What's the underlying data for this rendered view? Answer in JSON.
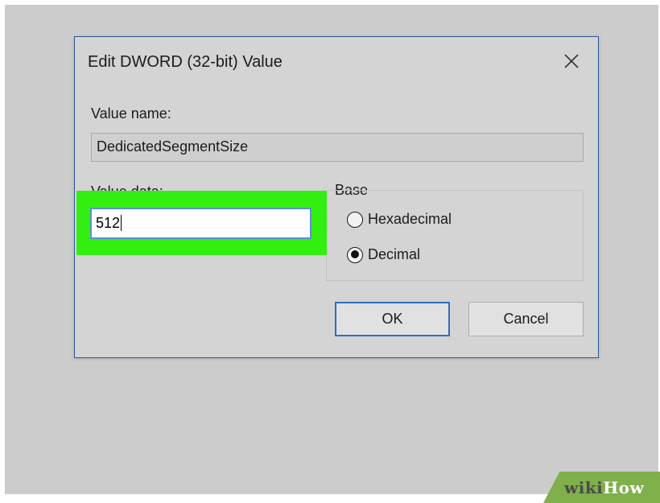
{
  "dialog": {
    "title": "Edit DWORD (32-bit) Value",
    "value_name_label": "Value name:",
    "value_name": "DedicatedSegmentSize",
    "value_data_label": "Value data:",
    "value_data": "512",
    "base_label": "Base",
    "radios": [
      {
        "label": "Hexadecimal",
        "checked": false
      },
      {
        "label": "Decimal",
        "checked": true
      }
    ],
    "ok_label": "OK",
    "cancel_label": "Cancel"
  },
  "watermark": {
    "part1": "wiki",
    "part2": "How"
  },
  "colors": {
    "highlight": "#33ee11",
    "dialog_border": "#2b579a",
    "ok_border": "#2f6dbf",
    "watermark_bg": "#7fb04c"
  }
}
